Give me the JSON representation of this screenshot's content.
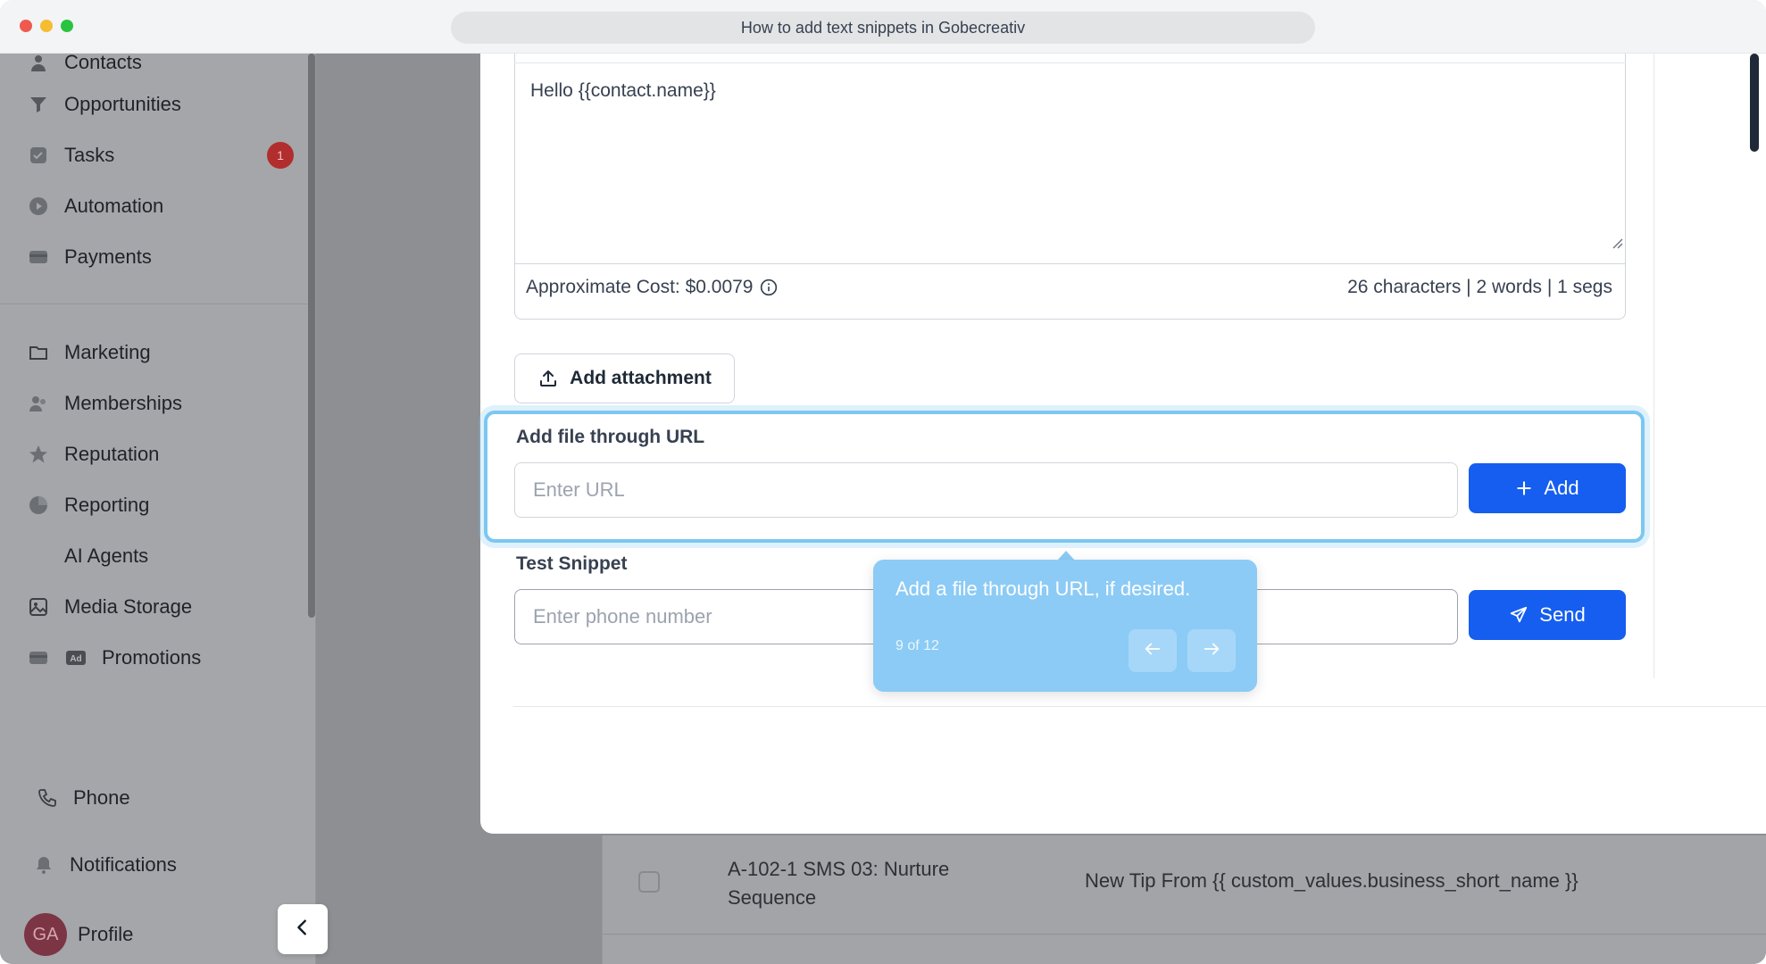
{
  "window": {
    "url_title": "How to add text snippets in Gobecreativ"
  },
  "sidebar": {
    "items": [
      {
        "label": "Contacts",
        "icon": "user-icon"
      },
      {
        "label": "Opportunities",
        "icon": "funnel-icon"
      },
      {
        "label": "Tasks",
        "icon": "checkbox-icon",
        "badge": "1"
      },
      {
        "label": "Automation",
        "icon": "automation-icon"
      },
      {
        "label": "Payments",
        "icon": "card-icon"
      },
      {
        "label": "Marketing",
        "icon": "folder-icon"
      },
      {
        "label": "Memberships",
        "icon": "users-icon"
      },
      {
        "label": "Reputation",
        "icon": "star-icon"
      },
      {
        "label": "Reporting",
        "icon": "pie-chart-icon"
      },
      {
        "label": "AI Agents",
        "icon": ""
      },
      {
        "label": "Media Storage",
        "icon": "image-icon"
      },
      {
        "label": "Promotions",
        "icon": "ad-icon"
      }
    ],
    "bottom": {
      "phone": "Phone",
      "notifications": "Notifications",
      "profile": "Profile",
      "avatar_initials": "GA"
    }
  },
  "editor": {
    "body_text": "Hello {{contact.name}}",
    "cost_label": "Approximate Cost: $0.0079",
    "counts": "26 characters | 2 words | 1 segs"
  },
  "attachment": {
    "button_label": "Add attachment",
    "url_section_label": "Add file through URL",
    "url_placeholder": "Enter URL",
    "add_button_label": "Add"
  },
  "test_snippet": {
    "label": "Test Snippet",
    "phone_placeholder": "Enter phone number",
    "send_button_label": "Send"
  },
  "tooltip": {
    "text": "Add a file through URL, if desired.",
    "step": "9 of 12"
  },
  "background_table": {
    "row_name": "A-102-1 SMS 03: Nurture Sequence",
    "row_subject": "New Tip From {{ custom_values.business_short_name }}"
  },
  "colors": {
    "primary": "#155eef",
    "highlight": "#7cc7f2",
    "tooltip": "#8ccbf5",
    "badge": "#b22d2d"
  }
}
